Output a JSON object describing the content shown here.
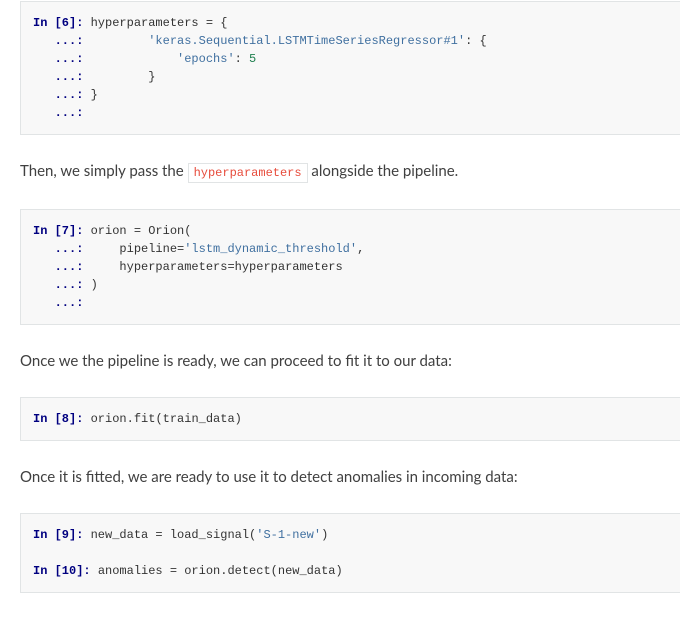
{
  "block1": {
    "pr1": "In [6]: ",
    "prc": "   ...: ",
    "l1a": "hyperparameters",
    "l1b": " = {",
    "l2s": "        ",
    "l2a": "'keras.Sequential.LSTMTimeSeriesRegressor#1'",
    "l2b": ": {",
    "l3s": "            ",
    "l3a": "'epochs'",
    "l3b": ": ",
    "l3c": "5",
    "l4s": "        ",
    "l4a": "}",
    "l5a": "}"
  },
  "para1_a": "Then, we simply pass the ",
  "para1_code": "hyperparameters",
  "para1_b": " alongside the pipeline.",
  "block2": {
    "pr1": "In [7]: ",
    "prc": "   ...: ",
    "l1a": "orion",
    "l1b": " = ",
    "l1c": "Orion",
    "l1d": "(",
    "l2s": "    ",
    "l2a": "pipeline",
    "l2b": "=",
    "l2c": "'lstm_dynamic_threshold'",
    "l2d": ",",
    "l3s": "    ",
    "l3a": "hyperparameters",
    "l3b": "=",
    "l3c": "hyperparameters",
    "l4a": ")"
  },
  "para2": "Once we the pipeline is ready, we can proceed to fit it to our data:",
  "block3": {
    "pr1": "In [8]: ",
    "l1a": "orion",
    "l1b": ".",
    "l1c": "fit",
    "l1d": "(",
    "l1e": "train_data",
    "l1f": ")"
  },
  "para3": "Once it is fitted, we are ready to use it to detect anomalies in incoming data:",
  "block4": {
    "pr1": "In [9]: ",
    "l1a": "new_data",
    "l1b": " = ",
    "l1c": "load_signal",
    "l1d": "(",
    "l1e": "'S-1-new'",
    "l1f": ")",
    "pr2": "In [10]: ",
    "l2a": "anomalies",
    "l2b": " = ",
    "l2c": "orion",
    "l2d": ".",
    "l2e": "detect",
    "l2f": "(",
    "l2g": "new_data",
    "l2h": ")"
  }
}
